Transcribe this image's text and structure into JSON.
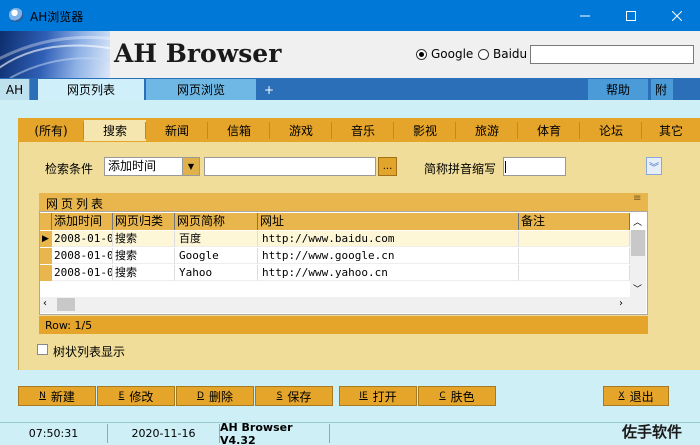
{
  "window": {
    "title": "AH浏览器",
    "minimize_icon": "minimize-icon",
    "maximize_icon": "maximize-icon",
    "close_icon": "close-icon"
  },
  "header": {
    "brand": "AH Browser",
    "engines": [
      {
        "label": "Google",
        "selected": true
      },
      {
        "label": "Baidu",
        "selected": false
      }
    ],
    "search_value": ""
  },
  "main_tabs": {
    "ah": "AH",
    "list": "网页列表",
    "browse": "网页浏览",
    "add": "+",
    "help": "帮助",
    "extra": "附"
  },
  "categories": [
    "(所有)",
    "搜索",
    "新闻",
    "信箱",
    "游戏",
    "音乐",
    "影视",
    "旅游",
    "体育",
    "论坛",
    "其它"
  ],
  "active_category": "搜索",
  "filter": {
    "condition_label": "检索条件",
    "condition_value": "添加时间",
    "condition_input": "",
    "dots_label": "...",
    "abbr_label": "简称拼音缩写",
    "abbr_value": ""
  },
  "list": {
    "title": "网页列表",
    "grip": "≡",
    "columns": [
      "添加时间",
      "网页归类",
      "网页简称",
      "网址",
      "备注"
    ],
    "rows": [
      {
        "time": "2008-01-0",
        "category": "搜索",
        "name": "百度",
        "url": "http://www.baidu.com",
        "note": ""
      },
      {
        "time": "2008-01-0",
        "category": "搜索",
        "name": "Google",
        "url": "http://www.google.cn",
        "note": ""
      },
      {
        "time": "2008-01-0",
        "category": "搜索",
        "name": "Yahoo",
        "url": "http://www.yahoo.cn",
        "note": ""
      }
    ],
    "row_status": "Row: 1/5"
  },
  "tree_option": {
    "label": "树状列表显示",
    "checked": false
  },
  "buttons": [
    {
      "key": "N",
      "label": "新建"
    },
    {
      "key": "E",
      "label": "修改"
    },
    {
      "key": "D",
      "label": "删除"
    },
    {
      "key": "S",
      "label": "保存"
    },
    {
      "key": "IE",
      "label": "打开"
    },
    {
      "key": "C",
      "label": "肤色"
    },
    {
      "key": "X",
      "label": "退出"
    }
  ],
  "status_bar": {
    "time": "07:50:31",
    "date": "2020-11-16",
    "version": "AH Browser V4.32"
  },
  "watermark": "佐手软件"
}
